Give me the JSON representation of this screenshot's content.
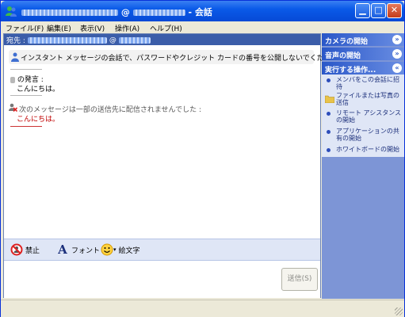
{
  "window": {
    "title_suffix": " - 会話"
  },
  "menu": {
    "items": [
      "ファイル(F)",
      "編集(E)",
      "表示(V)",
      "操作(A)",
      "ヘルプ(H)"
    ]
  },
  "to_bar": {
    "label": "宛先 :"
  },
  "messages": {
    "warning": "インスタント メッセージの会話で、パスワードやクレジット カードの番号を公開しないでください。",
    "sender_says": "の発言 :",
    "sent_text": "こんにちは。",
    "undelivered_notice": "次のメッセージは一部の送信先に配信されませんでした :",
    "undelivered_text": "こんにちは。"
  },
  "toolbar": {
    "block_label": "禁止",
    "font_label": "フォント",
    "emoticon_label": "絵文字"
  },
  "input": {
    "send_label": "送信(S)"
  },
  "sidepanel": {
    "sections": [
      {
        "label": "カメラの開始",
        "chevron": "»"
      },
      {
        "label": "音声の開始",
        "chevron": "»"
      },
      {
        "label": "実行する操作...",
        "chevron": "«"
      }
    ],
    "actions": [
      "メンバをこの会話に招待",
      "ファイルまたは写真の送信",
      "リモート アシスタンスの開始",
      "アプリケーションの共有の開始",
      "ホワイトボードの開始"
    ]
  },
  "colors": {
    "titlebar": "#0a5ae8",
    "undelivered_text": "#c00000",
    "sidepanel_bg": "#7d95d6"
  }
}
